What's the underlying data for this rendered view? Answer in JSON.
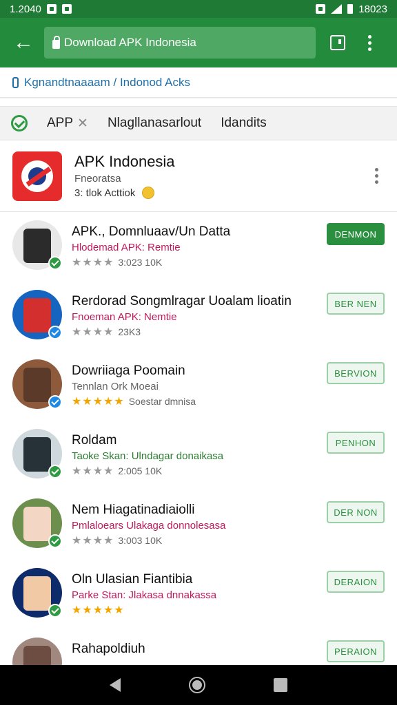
{
  "status_bar": {
    "time": "1.2040",
    "clock": "18023"
  },
  "toolbar": {
    "url": "Download APK Indonesia"
  },
  "breadcrumb": {
    "text": "Kgnandtnaaaam / Indonod Acks"
  },
  "filters": {
    "chip_label": "APP",
    "tab_2": "Nlagllanasarlout",
    "tab_3": "Idandits"
  },
  "featured": {
    "title": "APK Indonesia",
    "subtitle": "Fneoratsa",
    "meta": "3: tlok Acttiok"
  },
  "items": [
    {
      "title": "APK., Domnluaav/Un Datta",
      "subtitle": "Hlodemad APK: Remtie",
      "subtitle_color": "#c2185b",
      "meta": "3:023 10K",
      "stars": "★★★★",
      "gold": false,
      "button": "DENMON",
      "button_style": "solid",
      "avatar_bg": "#e8e8e8",
      "inner": "#2b2b2b",
      "badge": "#2e9a42"
    },
    {
      "title": "Rerdorad Songmlragar Uoalam lioatin",
      "subtitle": "Fnoeman APK: Nemtie",
      "subtitle_color": "#c2185b",
      "meta": "23K3",
      "stars": "★★★★",
      "gold": false,
      "button": "BER NEN",
      "button_style": "outline",
      "avatar_bg": "#1565c0",
      "inner": "#d32f2f",
      "badge": "#1e88e5"
    },
    {
      "title": "Dowriiaga Poomain",
      "subtitle": "Tennlan Ork Moeai",
      "subtitle_color": "#666666",
      "meta": "Soestar dmnisa",
      "stars": "★★★★★",
      "gold": true,
      "button": "BERVION",
      "button_style": "outline",
      "avatar_bg": "#8d5a3c",
      "inner": "#5b3a29",
      "badge": "#1e88e5"
    },
    {
      "title": "Roldam",
      "subtitle": "Taoke Skan: Ulndagar donaikasa",
      "subtitle_color": "#2e7d32",
      "meta": "2:005 10K",
      "stars": "★★★★",
      "gold": false,
      "button": "PENHON",
      "button_style": "outline",
      "avatar_bg": "#cfd8dc",
      "inner": "#263238",
      "badge": "#2e9a42"
    },
    {
      "title": "Nem Hiagatinadiaiolli",
      "subtitle": "Pmlaloears Ulakaga donnolesasa",
      "subtitle_color": "#c2185b",
      "meta": "3:003 10K",
      "stars": "★★★★",
      "gold": false,
      "button": "DER NON",
      "button_style": "outline",
      "avatar_bg": "#6d8f4e",
      "inner": "#f3d6c4",
      "badge": "#2e9a42"
    },
    {
      "title": "Oln Ulasian Fiantibia",
      "subtitle": "Parke Stan: Jlakasa dnnakassa",
      "subtitle_color": "#c2185b",
      "meta": "",
      "stars": "★★★★★",
      "gold": true,
      "button": "DERAION",
      "button_style": "outline",
      "avatar_bg": "#0d2b6b",
      "inner": "#f1c9a5",
      "badge": "#2e9a42"
    },
    {
      "title": "Rahapoldiuh",
      "subtitle": "",
      "subtitle_color": "#666666",
      "meta": "",
      "stars": "",
      "gold": false,
      "button": "PERAION",
      "button_style": "outline",
      "avatar_bg": "#a1887f",
      "inner": "#6d4c41",
      "badge": "#2e9a42"
    }
  ]
}
